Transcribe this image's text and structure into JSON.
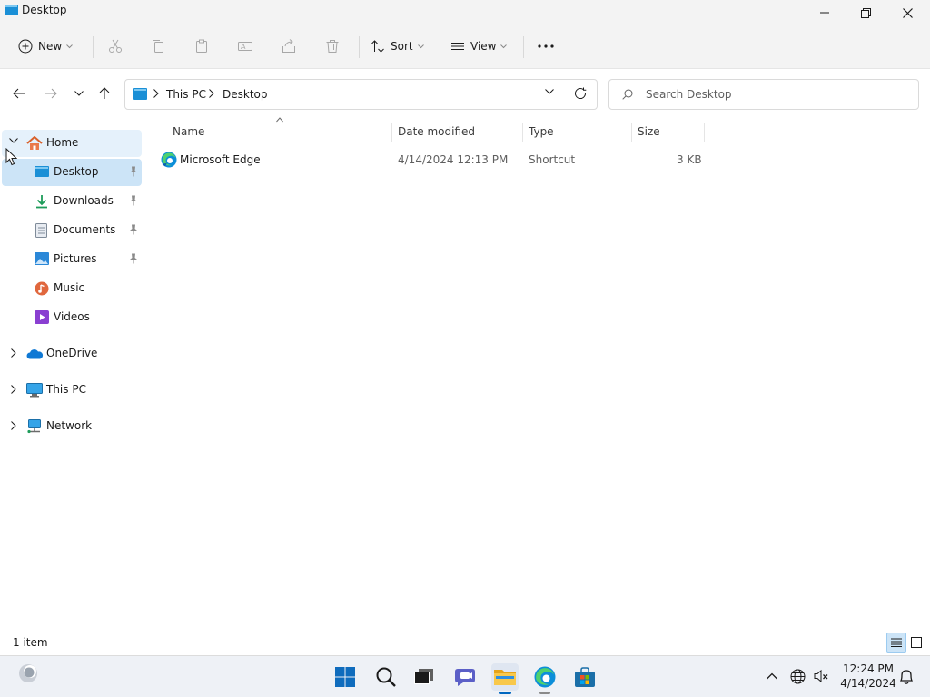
{
  "window": {
    "title": "Desktop",
    "controls": [
      "minimize-icon",
      "restore-icon",
      "close-icon"
    ]
  },
  "command_bar": {
    "new_label": "New",
    "sort_label": "Sort",
    "view_label": "View",
    "disabled_icons": [
      "cut-icon",
      "copy-icon",
      "paste-icon",
      "rename-icon",
      "share-icon",
      "delete-icon"
    ],
    "more_icon": "more-options-icon"
  },
  "address": {
    "crumbs": [
      "This PC",
      "Desktop"
    ],
    "search_placeholder": "Search Desktop"
  },
  "nav": {
    "home": "Home",
    "quick_access": [
      {
        "label": "Desktop",
        "icon": "desktop-folder-icon",
        "pinned": true,
        "selected": true
      },
      {
        "label": "Downloads",
        "icon": "downloads-icon",
        "pinned": true
      },
      {
        "label": "Documents",
        "icon": "documents-icon",
        "pinned": true
      },
      {
        "label": "Pictures",
        "icon": "pictures-icon",
        "pinned": true
      },
      {
        "label": "Music",
        "icon": "music-icon",
        "pinned": false
      },
      {
        "label": "Videos",
        "icon": "videos-icon",
        "pinned": false
      }
    ],
    "roots": [
      {
        "label": "OneDrive",
        "icon": "onedrive-icon"
      },
      {
        "label": "This PC",
        "icon": "this-pc-icon"
      },
      {
        "label": "Network",
        "icon": "network-icon"
      }
    ]
  },
  "columns": {
    "name": "Name",
    "date_modified": "Date modified",
    "type": "Type",
    "size": "Size"
  },
  "files": [
    {
      "name": "Microsoft Edge",
      "date_modified": "4/14/2024 12:13 PM",
      "type": "Shortcut",
      "size": "3 KB",
      "icon": "edge-icon"
    }
  ],
  "status": {
    "item_count": "1 item"
  },
  "taskbar": {
    "apps": [
      "start-icon",
      "search-icon",
      "task-view-icon",
      "teams-chat-icon",
      "file-explorer-icon",
      "edge-icon",
      "store-icon"
    ],
    "time": "12:24 PM",
    "date": "4/14/2024"
  },
  "colors": {
    "accent": "#0067c0",
    "selection": "#cce4f7",
    "chrome": "#f3f3f3"
  }
}
